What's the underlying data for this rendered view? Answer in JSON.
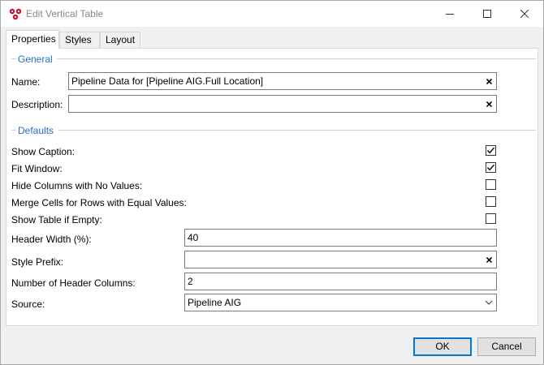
{
  "window": {
    "title": "Edit Vertical Table"
  },
  "tabs": [
    {
      "label": "Properties",
      "active": true
    },
    {
      "label": "Styles",
      "active": false
    },
    {
      "label": "Layout",
      "active": false
    }
  ],
  "general": {
    "header": "General",
    "name_label": "Name:",
    "name_value": "Pipeline Data for [Pipeline AIG.Full Location]",
    "description_label": "Description:",
    "description_value": ""
  },
  "defaults": {
    "header": "Defaults",
    "show_caption": {
      "label": "Show Caption:",
      "checked": true
    },
    "fit_window": {
      "label": "Fit Window:",
      "checked": true
    },
    "hide_columns": {
      "label": "Hide Columns with No Values:",
      "checked": false
    },
    "merge_cells": {
      "label": "Merge Cells for Rows with Equal Values:",
      "checked": false
    },
    "show_table_empty": {
      "label": "Show Table if Empty:",
      "checked": false
    },
    "header_width": {
      "label": "Header Width (%):",
      "value": "40"
    },
    "style_prefix": {
      "label": "Style Prefix:",
      "value": ""
    },
    "header_columns": {
      "label": "Number of Header Columns:",
      "value": "2"
    },
    "source": {
      "label": "Source:",
      "value": "Pipeline AIG"
    }
  },
  "buttons": {
    "ok": "OK",
    "cancel": "Cancel"
  },
  "colors": {
    "accent": "#1f6fc4",
    "focus_border": "#0078d7",
    "app_icon": "#c8102e"
  },
  "icons": {
    "app": "app-logo-icon",
    "minimize": "minimize-icon",
    "maximize": "maximize-icon",
    "close": "close-icon",
    "clear": "clear-x-icon",
    "check": "checkmark-icon",
    "dropdown": "chevron-down-icon"
  }
}
